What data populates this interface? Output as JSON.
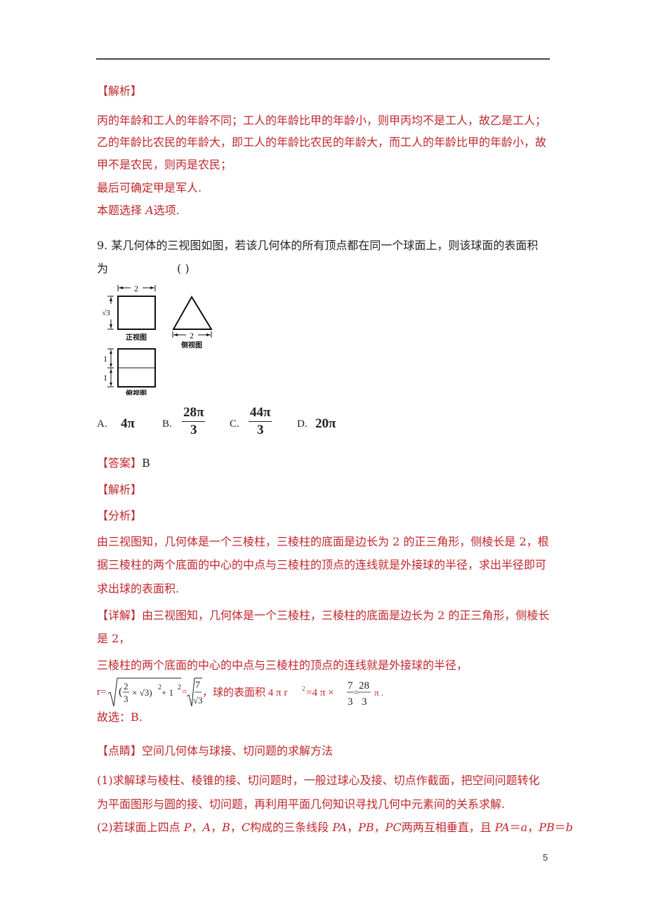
{
  "page_number": "5",
  "prev_solution": {
    "heading": "【解析】",
    "lines": [
      "丙的年龄和工人的年龄不同；工人的年龄比甲的年龄小，则甲丙均不是工人，故乙是工人；",
      "乙的年龄比农民的年龄大，即工人的年龄比农民的年龄大，而工人的年龄比甲的年龄小，故",
      "甲不是农民，则丙是农民；",
      "最后可确定甲是军人."
    ],
    "conclusion_prefix": "本题选择 ",
    "conclusion_option": "A",
    "conclusion_suffix": "选项."
  },
  "question": {
    "number": "9.",
    "text_line1": "某几何体的三视图如图，若该几何体的所有顶点都在同一个球面上，则该球面的表面积",
    "text_line2": "为",
    "paren": "(      )",
    "figure": {
      "front_view_label": "正视图",
      "side_view_label": "侧视图",
      "top_view_label": "俯视图",
      "front_width": "2",
      "front_height": "√3",
      "side_width": "2",
      "top_segment_1": "1",
      "top_segment_2": "1"
    },
    "choices": [
      {
        "label": "A.",
        "value": "4π"
      },
      {
        "label": "B.",
        "numerator": "28π",
        "denominator": "3"
      },
      {
        "label": "C.",
        "numerator": "44π",
        "denominator": "3"
      },
      {
        "label": "D.",
        "value": "20π"
      }
    ]
  },
  "answer": {
    "heading": "【答案】",
    "value": "B"
  },
  "analysis": {
    "heading": "【解析】",
    "sub_heading": "【分析】",
    "lines": [
      "由三视图知，几何体是一个三棱柱，三棱柱的底面是边长为 2 的正三角形，侧棱长是 2，根",
      "据三棱柱的两个底面的中心的中点与三棱柱的顶点的连线就是外接球的半径，求出半径即可",
      "求出球的表面积."
    ]
  },
  "detail": {
    "heading": "【详解】",
    "line1": "由三视图知，几何体是一个三棱柱，三棱柱的底面是边长为 2 的正三角形，侧棱长",
    "line2": "是 2，",
    "line3": "三棱柱的两个底面的中心的中点与三棱柱的顶点的连线就是外接球的半径，",
    "formula": {
      "r_eq": "r=",
      "inner_frac_num": "2",
      "inner_frac_den": "3",
      "times_sqrt3": "× √3)",
      "exp2": "2",
      "plus_one": " + 1",
      "eq": "=",
      "frac7_num": "7",
      "frac7_den": "√3",
      "text": "，球的表面积 4 π r",
      "text2": "=4 π ×",
      "frac73_num": "7",
      "frac73_den": "3",
      "eq2": "=",
      "frac28_num": "28",
      "frac28_den": "3",
      "tail": "π ."
    },
    "choose": "故选：B."
  },
  "tip": {
    "heading": "【点睛】",
    "title": "空间几何体与球接、切问题的求解方法",
    "line1": "(1)求解球与棱柱、棱锥的接、切问题时，一般过球心及接、切点作截面，把空间问题转化",
    "line2": "为平面图形与圆的接、切问题，再利用平面几何知识寻找几何中元素间的关系求解.",
    "line3_parts": [
      {
        "t": "(2)若球面上四点 ",
        "it": false
      },
      {
        "t": "P",
        "it": true
      },
      {
        "t": "，",
        "it": false
      },
      {
        "t": "A",
        "it": true
      },
      {
        "t": "，",
        "it": false
      },
      {
        "t": "B",
        "it": true
      },
      {
        "t": "，",
        "it": false
      },
      {
        "t": "C",
        "it": true
      },
      {
        "t": "构成的三条线段 ",
        "it": false
      },
      {
        "t": "PA",
        "it": true
      },
      {
        "t": "，",
        "it": false
      },
      {
        "t": "PB",
        "it": true
      },
      {
        "t": "，",
        "it": false
      },
      {
        "t": "PC",
        "it": true
      },
      {
        "t": "两两互相垂直，且 ",
        "it": false
      },
      {
        "t": "PA",
        "it": true
      },
      {
        "t": "＝",
        "it": false
      },
      {
        "t": "a",
        "it": true
      },
      {
        "t": "，",
        "it": false
      },
      {
        "t": "PB",
        "it": true
      },
      {
        "t": "＝",
        "it": false
      },
      {
        "t": "b",
        "it": true
      }
    ]
  }
}
